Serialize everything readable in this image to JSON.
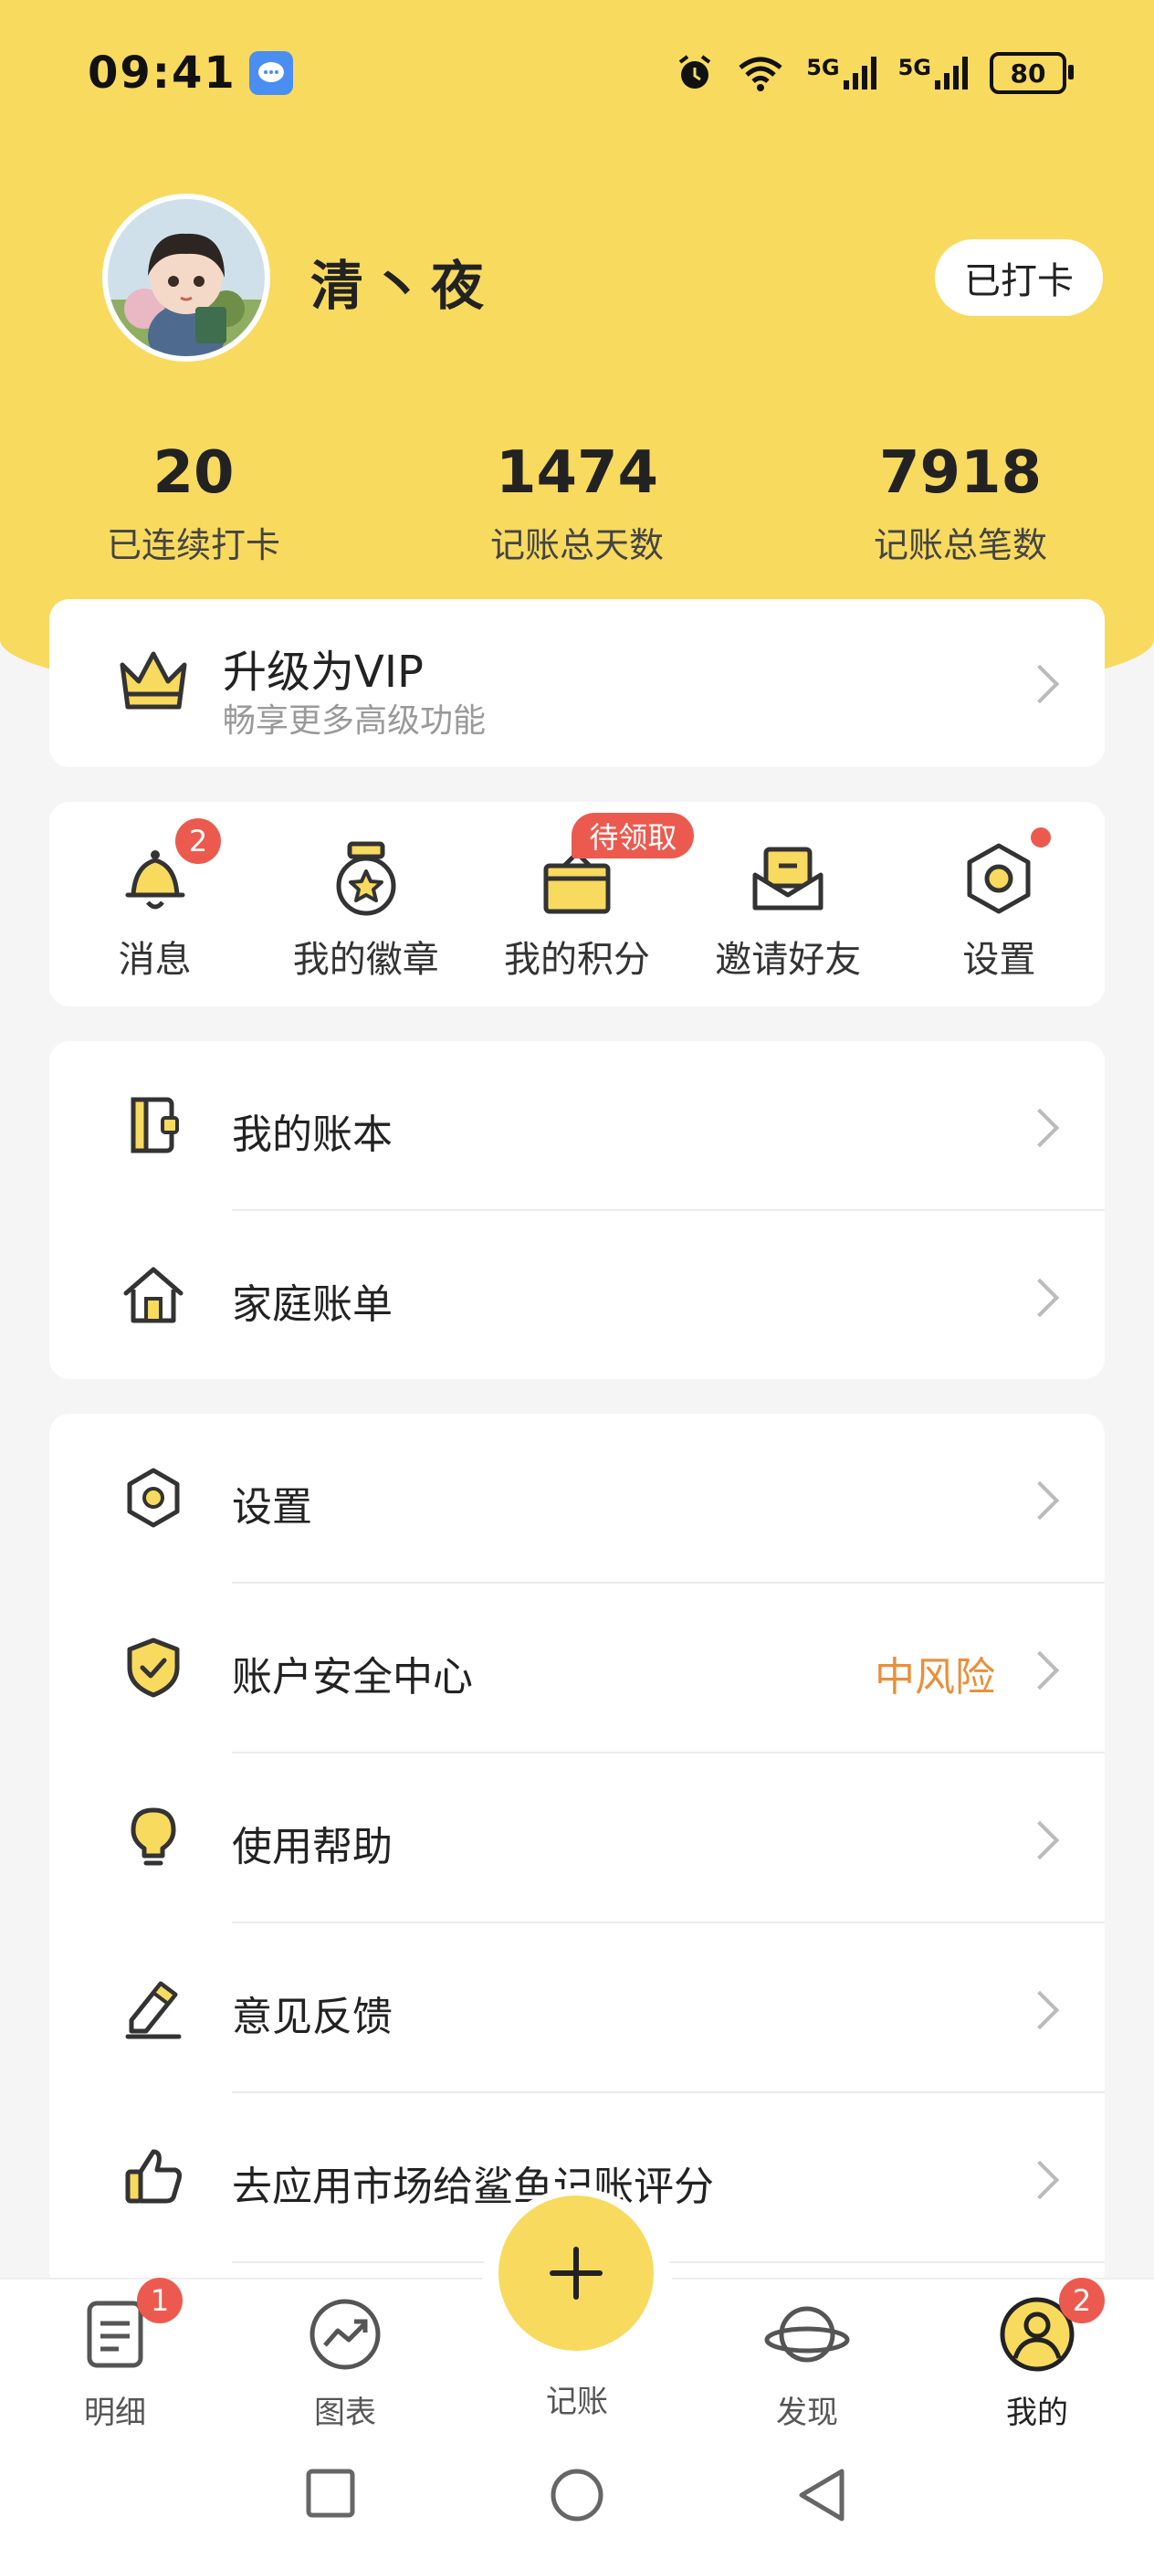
{
  "status": {
    "time": "09:41",
    "signal1": "5G",
    "signal2": "5G",
    "battery": "80"
  },
  "profile": {
    "username": "清丶夜",
    "checkin_label": "已打卡"
  },
  "stats": [
    {
      "value": "20",
      "label": "已连续打卡"
    },
    {
      "value": "1474",
      "label": "记账总天数"
    },
    {
      "value": "7918",
      "label": "记账总笔数"
    }
  ],
  "vip": {
    "title": "升级为VIP",
    "subtitle": "畅享更多高级功能"
  },
  "quick": [
    {
      "label": "消息",
      "icon": "bell-icon",
      "badge": "2"
    },
    {
      "label": "我的徽章",
      "icon": "medal-icon"
    },
    {
      "label": "我的积分",
      "icon": "gift-icon",
      "badge": "待领取"
    },
    {
      "label": "邀请好友",
      "icon": "envelope-icon"
    },
    {
      "label": "设置",
      "icon": "settings-hex-icon",
      "dot": true
    }
  ],
  "list1": [
    {
      "label": "我的账本",
      "icon": "ledger-icon"
    },
    {
      "label": "家庭账单",
      "icon": "home-icon"
    }
  ],
  "list2": [
    {
      "label": "设置",
      "icon": "settings-hex-icon"
    },
    {
      "label": "账户安全中心",
      "icon": "shield-check-icon",
      "value": "中风险"
    },
    {
      "label": "使用帮助",
      "icon": "lightbulb-icon"
    },
    {
      "label": "意见反馈",
      "icon": "pencil-icon"
    },
    {
      "label": "去应用市场给鲨鱼记账评分",
      "icon": "thumbs-up-icon"
    }
  ],
  "tabs": [
    {
      "label": "明细",
      "icon": "document-list-icon",
      "badge": "1"
    },
    {
      "label": "图表",
      "icon": "trend-chart-icon"
    },
    {
      "label": "记账",
      "icon": "plus-icon"
    },
    {
      "label": "发现",
      "icon": "planet-icon"
    },
    {
      "label": "我的",
      "icon": "user-circle-icon",
      "badge": "2"
    }
  ],
  "colors": {
    "accent": "#f8da5f",
    "badge": "#ec5a4f",
    "warning": "#e98f3a",
    "background": "#f5f5f5"
  }
}
